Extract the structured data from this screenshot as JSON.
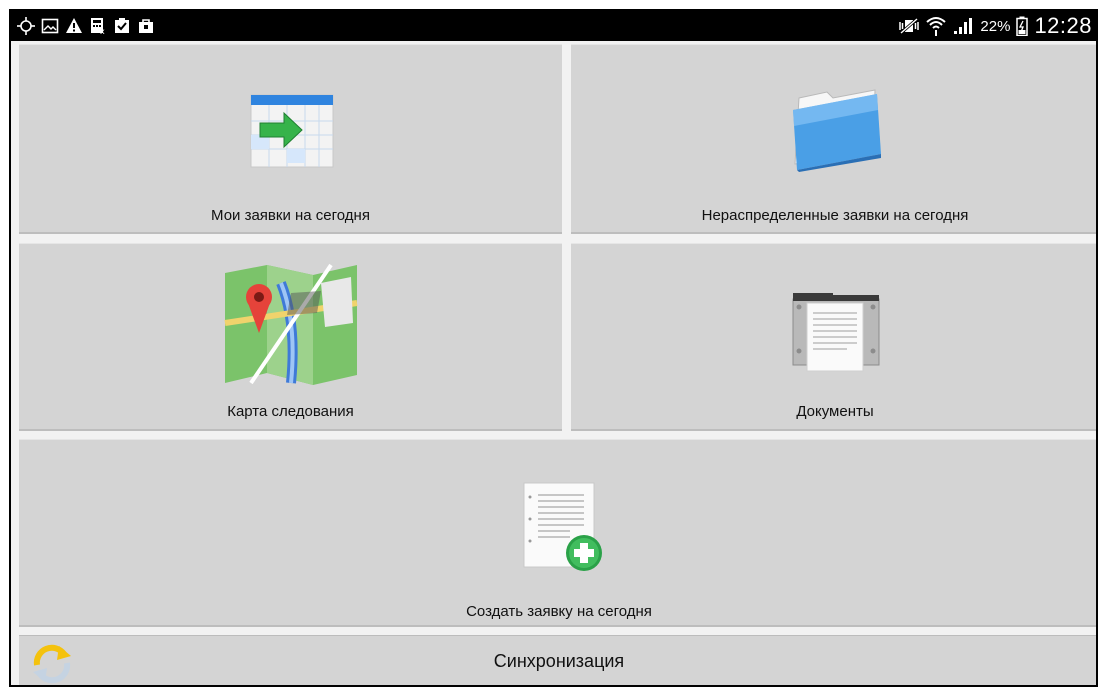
{
  "status_bar": {
    "left_icons": [
      "location-icon",
      "image-icon",
      "warning-icon",
      "calculator-icon",
      "clipboard-check-icon",
      "shop-bag-icon"
    ],
    "right_icons": [
      "vibrate-mute-icon",
      "wifi-icon",
      "signal-icon",
      "battery-icon"
    ],
    "battery_percent": "22%",
    "time": "12:28"
  },
  "tiles": [
    {
      "label": "Мои заявки на сегодня",
      "icon": "calendar-arrow-icon"
    },
    {
      "label": "Нераспределенные заявки на сегодня",
      "icon": "folder-icon"
    },
    {
      "label": "Карта следования",
      "icon": "map-pin-icon"
    },
    {
      "label": "Документы",
      "icon": "documents-tray-icon"
    },
    {
      "label": "Создать заявку на сегодня",
      "icon": "document-add-icon"
    }
  ],
  "sync": {
    "label": "Синхронизация",
    "icon": "sync-icon"
  },
  "colors": {
    "tile_bg": "#d4d4d4",
    "status_bg": "#000000",
    "accent_green": "#2aa148",
    "folder_blue": "#4a9fe6",
    "sync_yellow": "#f4c20d"
  }
}
